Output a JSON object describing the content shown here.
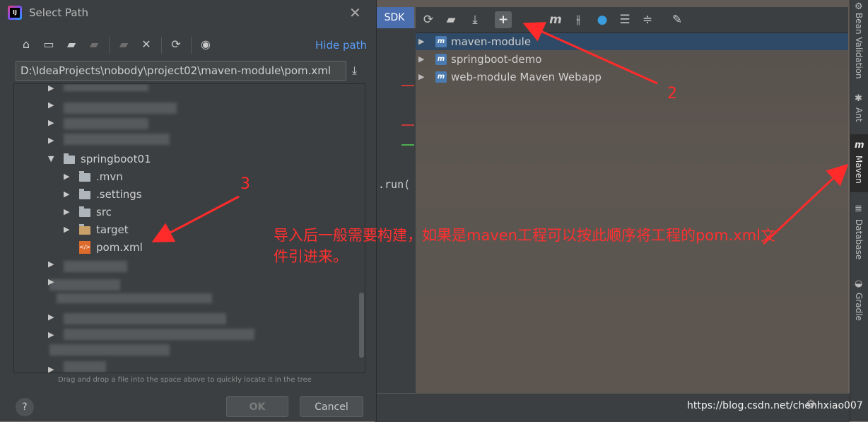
{
  "dialog": {
    "title": "Select Path",
    "hide_path": "Hide path",
    "path_value": "D:\\IdeaProjects\\nobody\\project02\\maven-module\\pom.xml",
    "hint": "Drag and drop a file into the space above to quickly locate it in the tree",
    "ok_label": "OK",
    "cancel_label": "Cancel",
    "help_label": "?",
    "logo_text": "IJ",
    "tree": {
      "springboot01": "springboot01",
      "mvn": ".mvn",
      "settings": ".settings",
      "src": "src",
      "target": "target",
      "pom": "pom.xml"
    }
  },
  "ide": {
    "sdk_tab": "SDK",
    "code_fragment": ".run(",
    "maven_projects": [
      {
        "label": "maven-module",
        "selected": true
      },
      {
        "label": "springboot-demo",
        "selected": false
      },
      {
        "label": "web-module Maven Webapp",
        "selected": false
      }
    ],
    "toolbar_icons": [
      "refresh-icon",
      "folder-refresh-icon",
      "download-icon",
      "add-icon",
      "maven-m-icon",
      "skip-tests-icon",
      "lightning-icon",
      "collapse-icon",
      "expand-icon",
      "wrench-icon"
    ]
  },
  "sidebar": {
    "tabs": [
      {
        "label": "Bean Validation",
        "active": false
      },
      {
        "label": "Ant",
        "active": false
      },
      {
        "label": "Maven",
        "active": true
      },
      {
        "label": "Database",
        "active": false
      },
      {
        "label": "Gradle",
        "active": false
      }
    ]
  },
  "annotations": {
    "num2": "2",
    "num3": "3",
    "text": "导入后一般需要构建，如果是maven工程可以按此顺序将工程的pom.xml文件引进来。",
    "color": "#ff2b2b"
  },
  "watermark": "https://blog.csdn.net/chenhxiao007"
}
